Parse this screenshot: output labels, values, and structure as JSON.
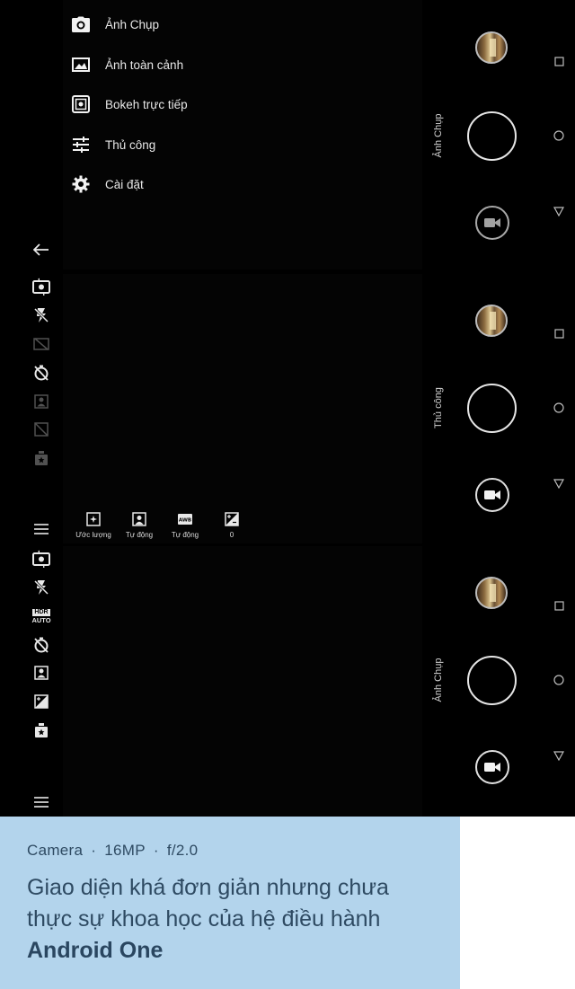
{
  "menu": {
    "items": [
      {
        "label": "Ảnh Chụp",
        "icon": "camera-icon"
      },
      {
        "label": "Ảnh toàn cảnh",
        "icon": "panorama-icon"
      },
      {
        "label": "Bokeh trực tiếp",
        "icon": "bokeh-icon"
      },
      {
        "label": "Thủ công",
        "icon": "sliders-icon"
      },
      {
        "label": "Cài đặt",
        "icon": "gear-icon"
      }
    ]
  },
  "toolbar": {
    "hdr_line1": "HDR",
    "hdr_line2": "AUTO"
  },
  "manual_settings": [
    {
      "label": "Ước lượng",
      "icon": "metering-icon"
    },
    {
      "label": "Tự động",
      "icon": "portrait-icon"
    },
    {
      "label": "Tự động",
      "icon": "awb-icon",
      "badge": "AWB"
    },
    {
      "label": "0",
      "icon": "exposure-icon"
    }
  ],
  "modes": {
    "panel1": "Ảnh Chụp",
    "panel2": "Thủ công",
    "panel3": "Ảnh Chụp"
  },
  "caption": {
    "app": "Camera",
    "megapixels": "16MP",
    "aperture": "f/2.0",
    "separator": "·",
    "text": "Giao diện khá đơn giản nhưng chưa thực sự khoa học của hệ điều hành",
    "bold": "Android One"
  },
  "colors": {
    "caption_bg": "#b3d4ec",
    "caption_text": "#2e4a62",
    "screen_bg": "#000000"
  }
}
